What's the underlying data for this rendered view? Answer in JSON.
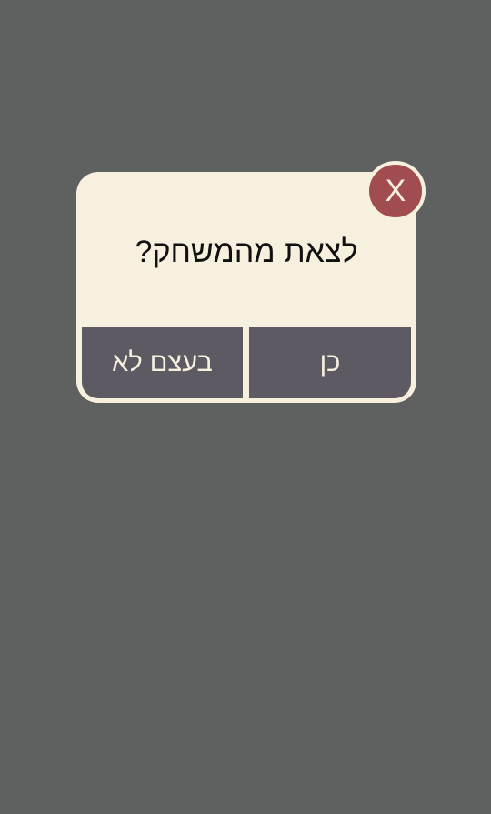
{
  "dialog": {
    "question": "לצאת מהמשחק?",
    "no_label": "בעצם לא",
    "yes_label": "כן",
    "close_label": "X"
  },
  "colors": {
    "background": "#5f6160",
    "dialog_background": "#f7f0df",
    "button_background": "#5e5a63",
    "close_background": "#a14d50"
  }
}
